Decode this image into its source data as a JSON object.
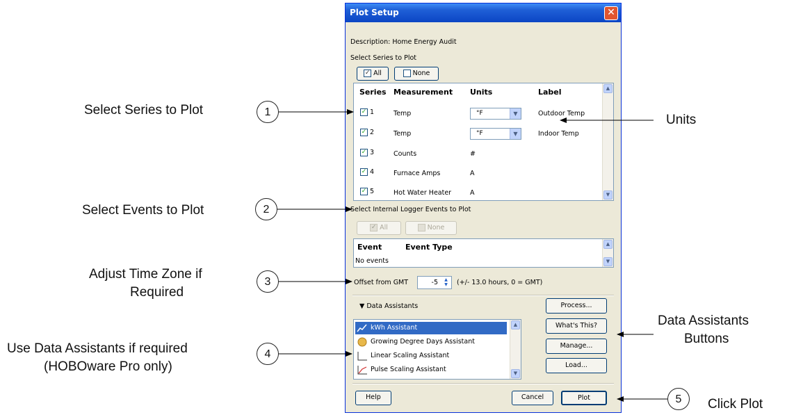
{
  "annotations": {
    "select_series": "Select Series to Plot",
    "select_events": "Select Events to Plot",
    "time_zone_line1": "Adjust Time Zone if",
    "time_zone_line2": "Required",
    "data_assistants_line1": "Use Data Assistants if required",
    "data_assistants_line2": "(HOBOware Pro only)",
    "units": "Units",
    "assistant_buttons_line1": "Data Assistants",
    "assistant_buttons_line2": "Buttons",
    "click_plot": "Click Plot",
    "step_numbers": [
      "1",
      "2",
      "3",
      "4",
      "5"
    ]
  },
  "dialog": {
    "title": "Plot Setup",
    "close_icon": "close-icon",
    "description": "Description: Home Energy Audit",
    "select_series_label": "Select Series to Plot",
    "all_button": "All",
    "none_button": "None",
    "series_table": {
      "headers": [
        "Series",
        "Measurement",
        "Units",
        "Label"
      ],
      "rows": [
        {
          "series": "1",
          "measurement": "Temp",
          "units": "°F",
          "label": "Outdoor Temp",
          "checked": true
        },
        {
          "series": "2",
          "measurement": "Temp",
          "units": "°F",
          "label": "Indoor Temp",
          "checked": true
        },
        {
          "series": "3",
          "measurement": "Counts",
          "units": "#",
          "label": "",
          "checked": true
        },
        {
          "series": "4",
          "measurement": "Furnace Amps",
          "units": "A",
          "label": "",
          "checked": true
        },
        {
          "series": "5",
          "measurement": "Hot Water Heater",
          "units": "A",
          "label": "",
          "checked": true
        }
      ]
    },
    "select_events_label": "Select Internal Logger Events to Plot",
    "events_all_button": "All",
    "events_none_button": "None",
    "events_table": {
      "headers": [
        "Event",
        "Event Type"
      ],
      "empty_text": "No events"
    },
    "offset_label": "Offset from GMT",
    "offset_value": "-5",
    "offset_hint": "(+/- 13.0 hours, 0 = GMT)",
    "data_assistants_toggle": "▼ Data Assistants",
    "assistants": [
      {
        "name": "kWh Assistant",
        "selected": true,
        "icon": "kwh-chart-icon"
      },
      {
        "name": "Growing Degree Days Assistant",
        "selected": false,
        "icon": "sun-icon"
      },
      {
        "name": "Linear Scaling Assistant",
        "selected": false,
        "icon": "linear-scale-icon"
      },
      {
        "name": "Pulse Scaling Assistant",
        "selected": false,
        "icon": "pulse-scale-icon"
      }
    ],
    "process_button": "Process...",
    "whats_this_button": "What's This?",
    "manage_button": "Manage...",
    "load_button": "Load...",
    "help_button": "Help",
    "cancel_button": "Cancel",
    "plot_button": "Plot"
  },
  "colors": {
    "title_bar": "#0b45c4",
    "dialog_bg": "#ece9d8",
    "selection": "#316ac5",
    "close_button": "#e0552f",
    "check_mark": "#21a121"
  }
}
